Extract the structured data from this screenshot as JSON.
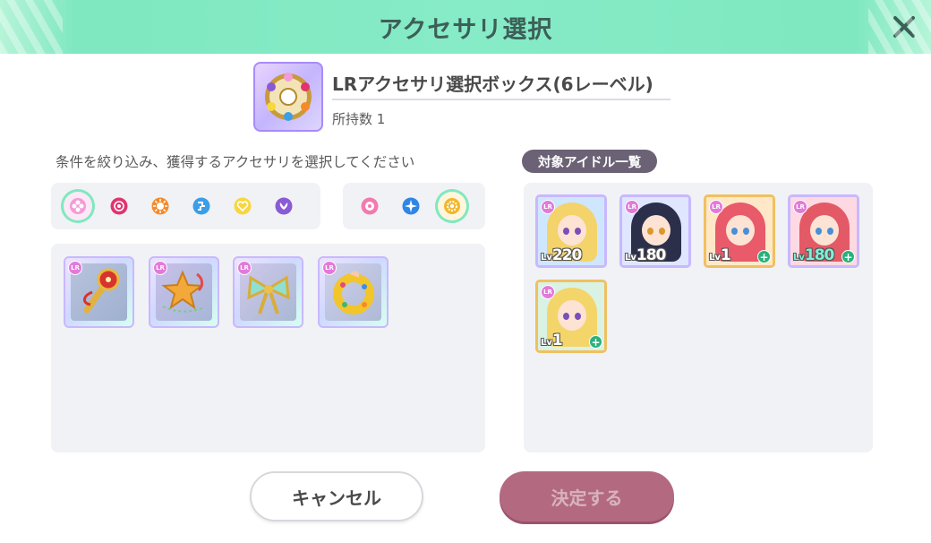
{
  "header": {
    "title": "アクセサリ選択"
  },
  "item": {
    "name": "LRアクセサリ選択ボックス(6レーベル)",
    "count_label": "所持数 1"
  },
  "instruction": "条件を絞り込み、獲得するアクセサリを選択してください",
  "idol_list_label": "対象アイドル一覧",
  "filters_group1": [
    {
      "icon": "flower-icon",
      "color": "#f39bd8",
      "selected": true
    },
    {
      "icon": "rose-icon",
      "color": "#e0346e",
      "selected": false
    },
    {
      "icon": "sun-icon",
      "color": "#f58a2a",
      "selected": false
    },
    {
      "icon": "circuit-icon",
      "color": "#3a9ee8",
      "selected": false
    },
    {
      "icon": "heart-icon",
      "color": "#f7d640",
      "selected": false
    },
    {
      "icon": "wing-icon",
      "color": "#8b5ad6",
      "selected": false
    }
  ],
  "filters_group2": [
    {
      "icon": "sakura-icon",
      "color": "#f27ab0",
      "selected": false
    },
    {
      "icon": "star-icon",
      "color": "#2f86e6",
      "selected": false
    },
    {
      "icon": "sunflower-icon",
      "color": "#f2b62c",
      "selected": true
    }
  ],
  "accessories": [
    {
      "name": "scepter",
      "badge": "LR"
    },
    {
      "name": "star-wand",
      "badge": "LR"
    },
    {
      "name": "ribbon",
      "badge": "LR"
    },
    {
      "name": "wreath",
      "badge": "LR"
    }
  ],
  "idols": [
    {
      "level_prefix": "Lv",
      "level": "220",
      "hair": "#f3d36a",
      "bg": "#cfe6ff",
      "frame": "#c8b8ff",
      "plus": false
    },
    {
      "level_prefix": "Lv",
      "level": "180",
      "hair": "#2b2f4a",
      "bg": "#dfe6ff",
      "frame": "#c8b8ff",
      "plus": false
    },
    {
      "level_prefix": "Lv",
      "level": "1",
      "hair": "#e95a6a",
      "bg": "#ffe8c8",
      "frame": "#f0c060",
      "plus": true
    },
    {
      "level_prefix": "Lv",
      "level": "180",
      "hair": "#e35a66",
      "bg": "#ffd9e2",
      "frame": "#c8b8ff",
      "plus": true
    },
    {
      "level_prefix": "Lv",
      "level": "1",
      "hair": "#f4d56a",
      "bg": "#d9f2e4",
      "frame": "#f0c060",
      "plus": true
    }
  ],
  "buttons": {
    "cancel": "キャンセル",
    "confirm": "決定する"
  },
  "colors": {
    "header": "#86ebc7",
    "confirm": "#b36a80",
    "accent": "#7fe8c0"
  }
}
